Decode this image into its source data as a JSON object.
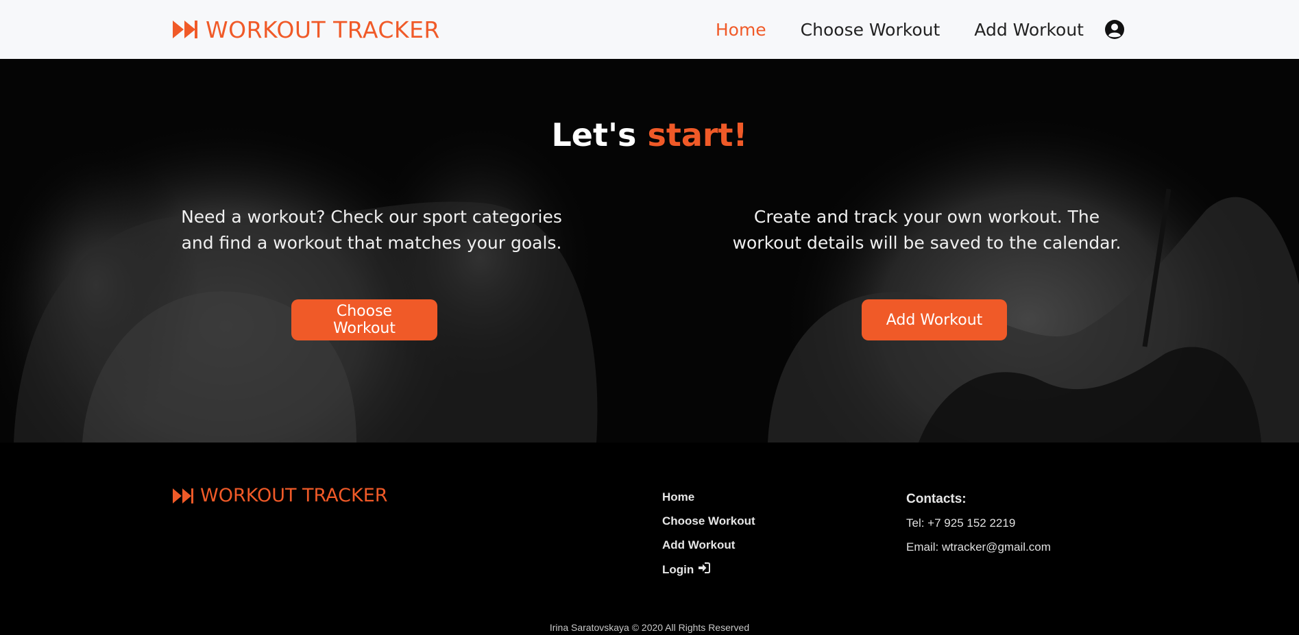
{
  "brand": {
    "name": "WORKOUT TRACKER",
    "icon": "fast-forward-icon"
  },
  "nav": {
    "items": [
      {
        "label": "Home",
        "active": true
      },
      {
        "label": "Choose Workout",
        "active": false
      },
      {
        "label": "Add Workout",
        "active": false
      }
    ],
    "user_icon": "user-circle-icon"
  },
  "hero": {
    "title_main": "Let's",
    "title_accent": "start!",
    "left_text": "Need a workout? Check our sport categories and find a workout that matches your goals.",
    "left_button": "Choose Workout",
    "right_text": "Create and track your own workout. The workout details will be saved to the calendar.",
    "right_button": "Add Workout"
  },
  "footer": {
    "brand": "WORKOUT TRACKER",
    "links": [
      "Home",
      "Choose Workout",
      "Add Workout",
      "Login"
    ],
    "login_icon": "sign-in-icon",
    "contacts_title": "Contacts:",
    "phone": "Tel: +7 925 152 2219",
    "email": "Email: wtracker@gmail.com",
    "copyright": "Irina Saratovskaya © 2020 All Rights Reserved"
  },
  "colors": {
    "accent": "#f05a28",
    "navbar_bg": "#f7f8fa",
    "footer_bg": "#000000"
  }
}
